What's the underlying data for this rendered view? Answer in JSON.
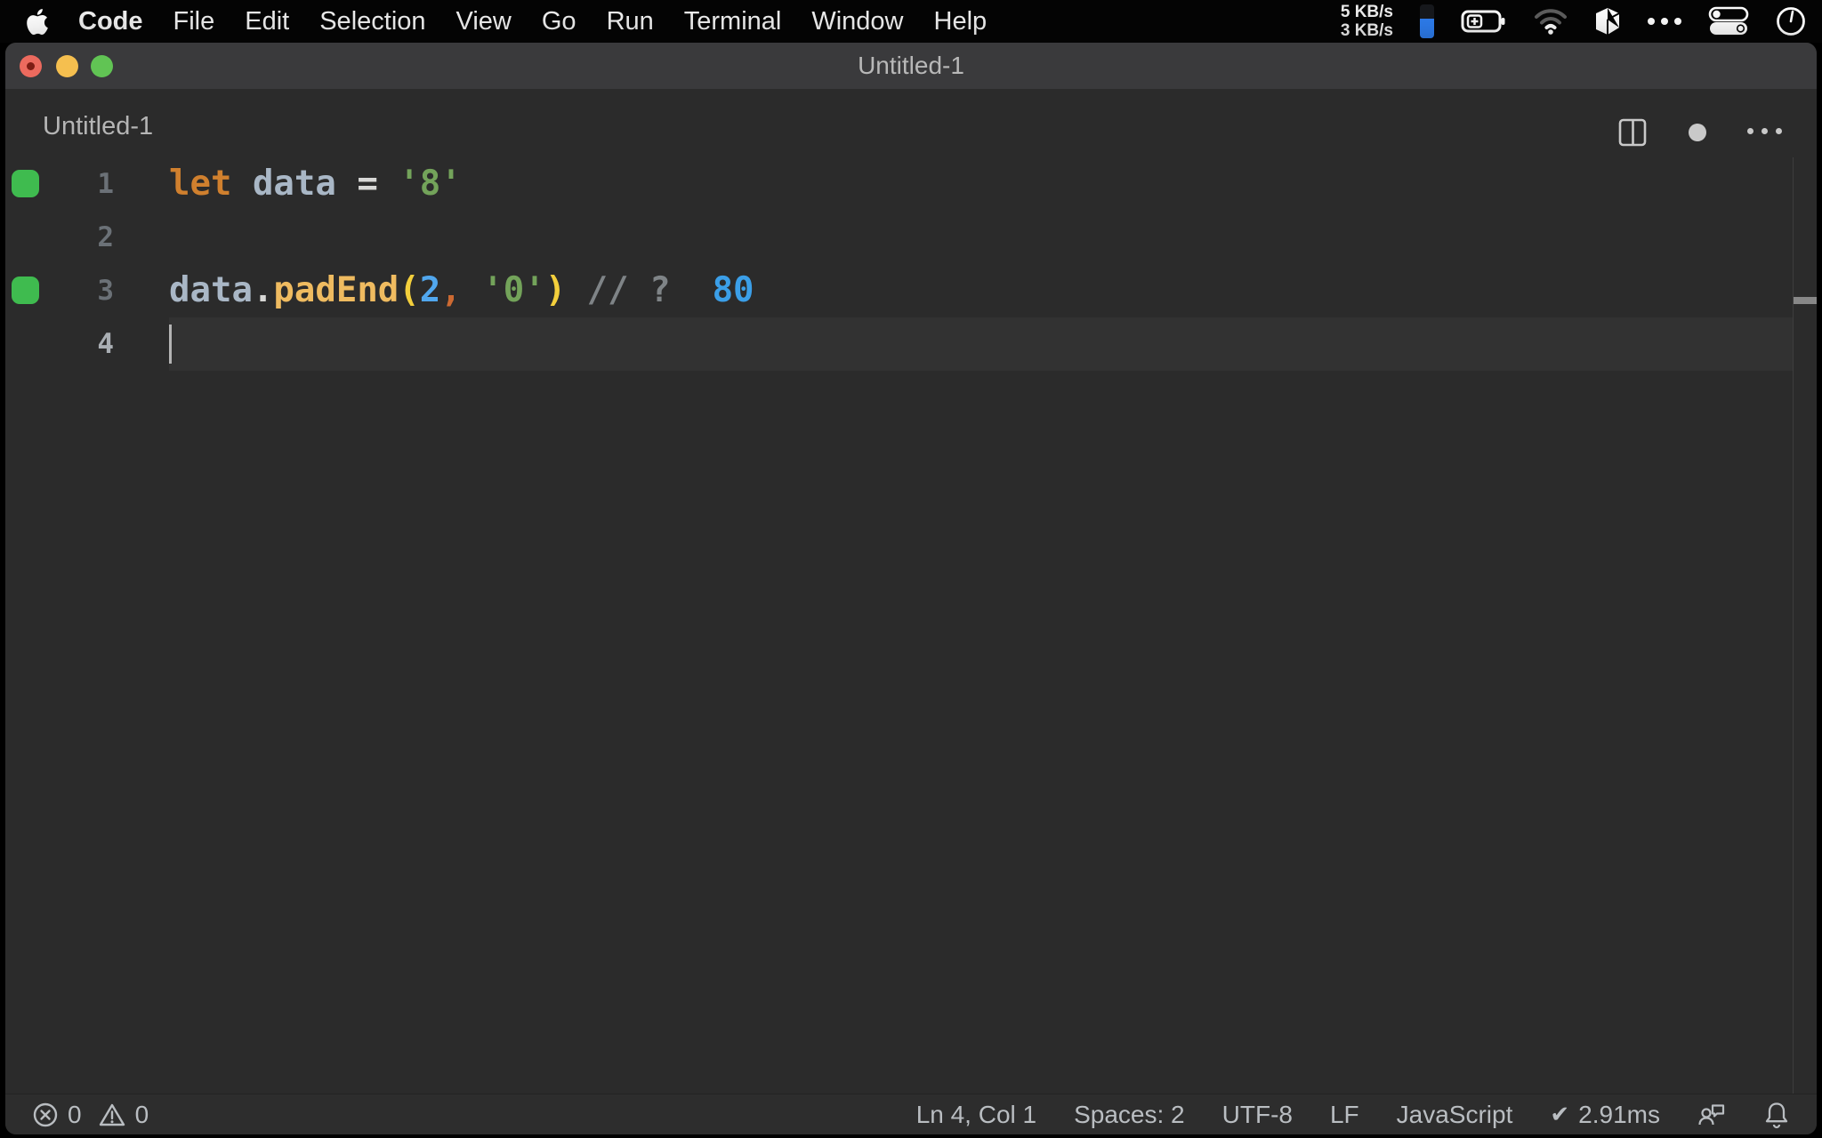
{
  "menu_bar": {
    "apple_icon": "apple-logo",
    "active_app": "Code",
    "items": [
      "File",
      "Edit",
      "Selection",
      "View",
      "Go",
      "Run",
      "Terminal",
      "Window",
      "Help"
    ],
    "network": {
      "up": "5 KB/s",
      "down": "3 KB/s"
    },
    "status_icons": [
      "indicator-bar",
      "battery-charging",
      "wifi",
      "box-app",
      "ellipsis-menu",
      "control-center",
      "clock"
    ]
  },
  "window": {
    "title": "Untitled-1",
    "traffic_lights": {
      "close": "#ec6a5e",
      "minimize": "#f5bf4f",
      "zoom": "#61c454",
      "modified_dot": "#7e1d14"
    },
    "tab_bar": {
      "tab_label": "Untitled-1",
      "actions": [
        "split-editor",
        "unsaved-changes-indicator",
        "more-actions"
      ]
    }
  },
  "editor": {
    "language_mode": "JavaScript",
    "coverage_color": "#3fbb4f",
    "lines": [
      {
        "number": "1",
        "coverage": true,
        "active": false,
        "tokens": [
          [
            "kw",
            "let"
          ],
          [
            "pl",
            " "
          ],
          [
            "var",
            "data"
          ],
          [
            "pl",
            " "
          ],
          [
            "op",
            "="
          ],
          [
            "pl",
            " "
          ],
          [
            "str",
            "'8'"
          ]
        ]
      },
      {
        "number": "2",
        "coverage": false,
        "active": false,
        "tokens": []
      },
      {
        "number": "3",
        "coverage": true,
        "active": false,
        "tokens": [
          [
            "var",
            "data"
          ],
          [
            "op",
            "."
          ],
          [
            "fn",
            "padEnd"
          ],
          [
            "paren",
            "("
          ],
          [
            "num",
            "2"
          ],
          [
            "comma",
            ","
          ],
          [
            "pl",
            " "
          ],
          [
            "str",
            "'0'"
          ],
          [
            "paren",
            ")"
          ],
          [
            "pl",
            " "
          ],
          [
            "comment",
            "// ?"
          ]
        ],
        "result": "80"
      },
      {
        "number": "4",
        "coverage": false,
        "active": true,
        "tokens": [],
        "cursor": true
      }
    ],
    "syntax_colors": {
      "keyword": "#d0802e",
      "variable": "#a9b7c6",
      "operator": "#d8d8d6",
      "function": "#efbb60",
      "paren": "#f3cf3c",
      "number": "#51a7ee",
      "comma": "#cd6a32",
      "string": "#73a35a",
      "comment": "#7f8487",
      "inline_result": "#3b9fe8"
    }
  },
  "status_bar": {
    "errors": "0",
    "warnings": "0",
    "cursor_position": "Ln 4, Col 1",
    "indentation": "Spaces: 2",
    "encoding": "UTF-8",
    "eol": "LF",
    "language": "JavaScript",
    "run_check": "✔",
    "run_time": "2.91ms"
  }
}
